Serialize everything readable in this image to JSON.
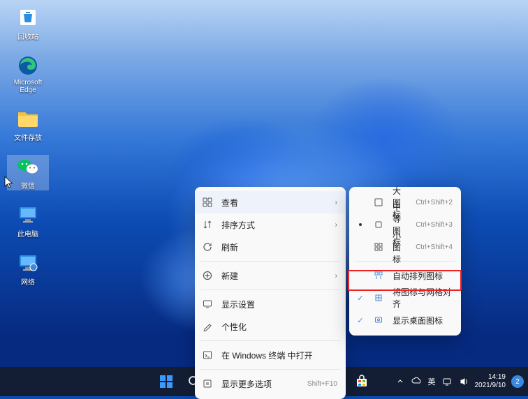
{
  "desktop_icons": [
    {
      "label": "回收站",
      "name": "recycle-bin"
    },
    {
      "label": "Microsoft Edge",
      "name": "edge"
    },
    {
      "label": "文件存放",
      "name": "folder-files"
    },
    {
      "label": "微信",
      "name": "wechat"
    },
    {
      "label": "此电脑",
      "name": "this-pc"
    },
    {
      "label": "网络",
      "name": "network"
    }
  ],
  "context_menu": {
    "view": {
      "label": "查看"
    },
    "sort": {
      "label": "排序方式"
    },
    "refresh": {
      "label": "刷新"
    },
    "new": {
      "label": "新建"
    },
    "display": {
      "label": "显示设置"
    },
    "personalize": {
      "label": "个性化"
    },
    "terminal": {
      "label": "在 Windows 终端 中打开"
    },
    "more": {
      "label": "显示更多选项",
      "shortcut": "Shift+F10"
    }
  },
  "view_submenu": {
    "large": {
      "label": "大图标",
      "shortcut": "Ctrl+Shift+2"
    },
    "medium": {
      "label": "中等图标",
      "shortcut": "Ctrl+Shift+3"
    },
    "small": {
      "label": "小图标",
      "shortcut": "Ctrl+Shift+4"
    },
    "auto_arrange": {
      "label": "自动排列图标"
    },
    "align_grid": {
      "label": "将图标与网格对齐"
    },
    "show_icons": {
      "label": "显示桌面图标"
    }
  },
  "tray": {
    "ime": "英",
    "time": "14:19",
    "date": "2021/9/10",
    "user_badge": "2"
  }
}
